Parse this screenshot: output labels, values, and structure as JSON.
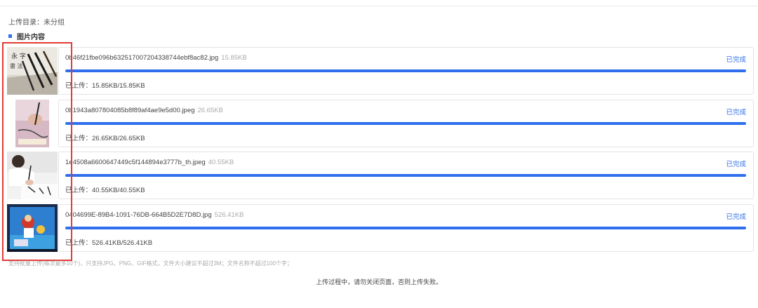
{
  "upload_dir": {
    "label": "上传目录：未分组"
  },
  "section": {
    "title": "图片内容"
  },
  "accent_color": "#2f6fed",
  "files": [
    {
      "name": "0b46f21fbe096b632517007204338744ebf8ac82.jpg",
      "size": "15.85KB",
      "status": "已完成",
      "uploaded_text": "已上传：15.85KB/15.85KB",
      "progress": 1.0,
      "thumb": "calligraphy-brushes-image"
    },
    {
      "name": "0b1943a807804085b8f89af4ae9e5d00.jpeg",
      "size": "26.65KB",
      "status": "已完成",
      "uploaded_text": "已上传：26.65KB/26.65KB",
      "progress": 1.0,
      "thumb": "painting-hand-image"
    },
    {
      "name": "1e4508a6600647449c5f144894e3777b_th.jpeg",
      "size": "40.55KB",
      "status": "已完成",
      "uploaded_text": "已上传：40.55KB/40.55KB",
      "progress": 1.0,
      "thumb": "person-writing-image"
    },
    {
      "name": "0404699E-89B4-1091-76DB-664B5D2E7D8D.jpg",
      "size": "526.41KB",
      "status": "已完成",
      "uploaded_text": "已上传：526.41KB/526.41KB",
      "progress": 1.0,
      "thumb": "cartoon-screenshot-image"
    }
  ],
  "hint": "支持批量上传(每次最多10个)，只支持JPG、PNG、GIF格式，文件大小建议不超过3M；文件名称不超过100个字；",
  "warning": "上传过程中，请勿关闭页面，否则上传失败。"
}
